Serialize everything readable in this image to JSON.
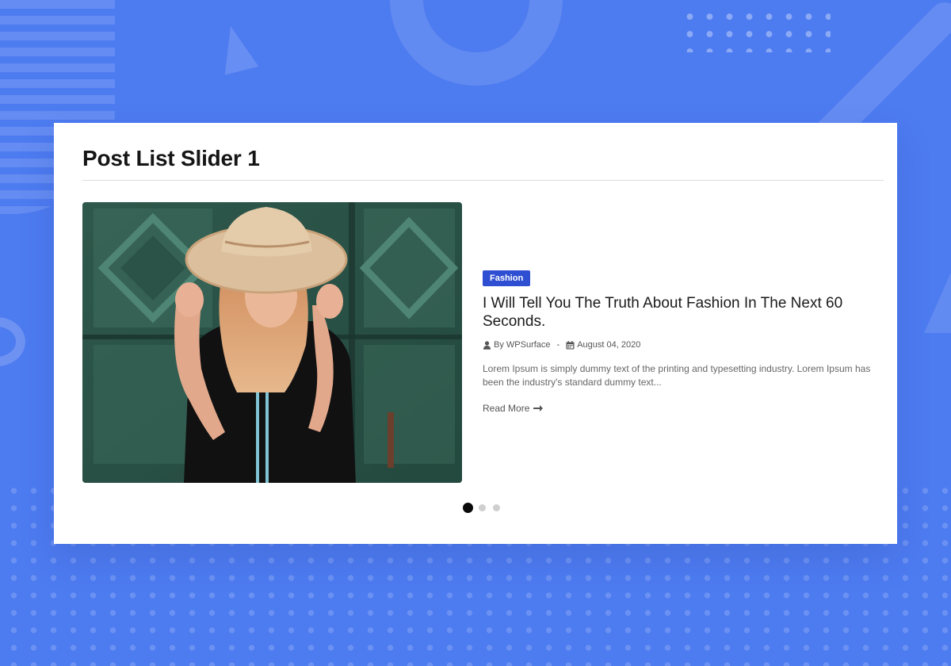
{
  "widget": {
    "title": "Post List Slider 1"
  },
  "post": {
    "category": "Fashion",
    "title": "I Will Tell You The Truth About Fashion In The Next 60 Seconds.",
    "author": "By WPSurface",
    "separator": "-",
    "date": "August 04, 2020",
    "excerpt": "Lorem Ipsum is simply dummy text of the printing and typesetting industry. Lorem Ipsum has been the industry's standard dummy text...",
    "read_more": "Read More"
  },
  "slider": {
    "dot_count": 3,
    "active_index": 0
  },
  "icons": {
    "author": "user-icon",
    "date": "calendar-icon",
    "read_more": "arrow-right-icon"
  },
  "colors": {
    "background": "#4d7bf0",
    "badge": "#2f4fd3",
    "active_dot": "#0a0a0a",
    "inactive_dot": "#cfcfcf"
  }
}
